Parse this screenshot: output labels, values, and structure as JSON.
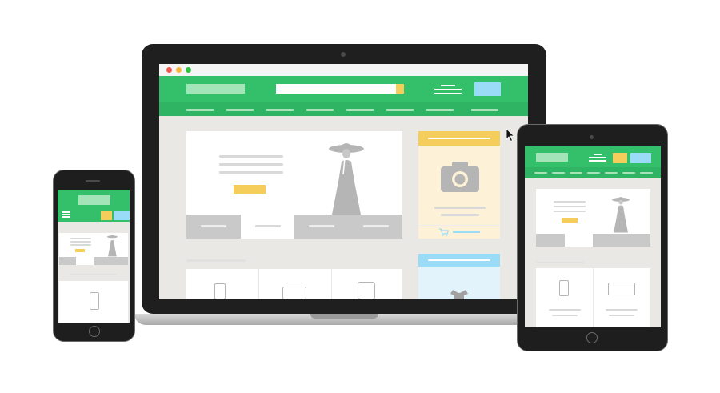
{
  "devices": {
    "laptop": {
      "type": "laptop"
    },
    "tablet": {
      "type": "tablet"
    },
    "phone": {
      "type": "phone"
    }
  },
  "colors": {
    "brand_green": "#34c06a",
    "nav_green": "#2fb463",
    "accent_yellow": "#f4cd5a",
    "accent_blue": "#9adbf8",
    "panel_yellow": "#fdf2d7",
    "panel_blue": "#e3f3fb",
    "screen_bg": "#eae8e4",
    "device_frame": "#1f1f1f"
  },
  "icons": [
    "camera-icon",
    "cart-icon",
    "mouse-cursor-icon",
    "woman-hat-silhouette-icon",
    "smartphone-icon",
    "monitor-icon",
    "tablet-icon",
    "dress-icon"
  ]
}
